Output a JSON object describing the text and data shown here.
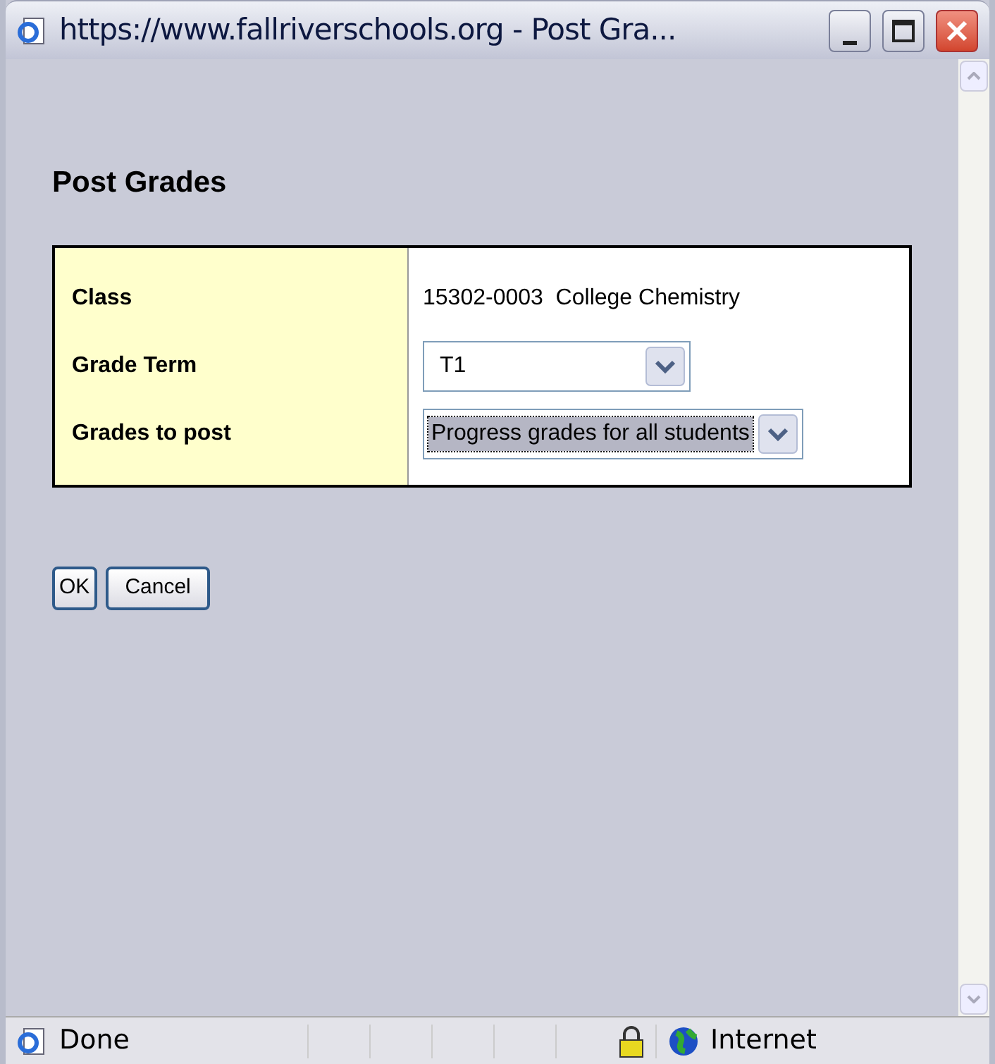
{
  "window": {
    "title": "https://www.fallriverschools.org - Post Gra..."
  },
  "heading": "Post Grades",
  "form": [
    {
      "kind": "text",
      "label": "Class",
      "value": "15302-0003  College Chemistry"
    },
    {
      "kind": "select",
      "label": "Grade Term",
      "value": "T1",
      "focused": false
    },
    {
      "kind": "select",
      "label": "Grades to post",
      "value": "Progress grades for all students",
      "focused": true
    }
  ],
  "buttons": [
    "OK",
    "Cancel"
  ],
  "status_bar": {
    "text": "Done",
    "zone": "Internet"
  }
}
